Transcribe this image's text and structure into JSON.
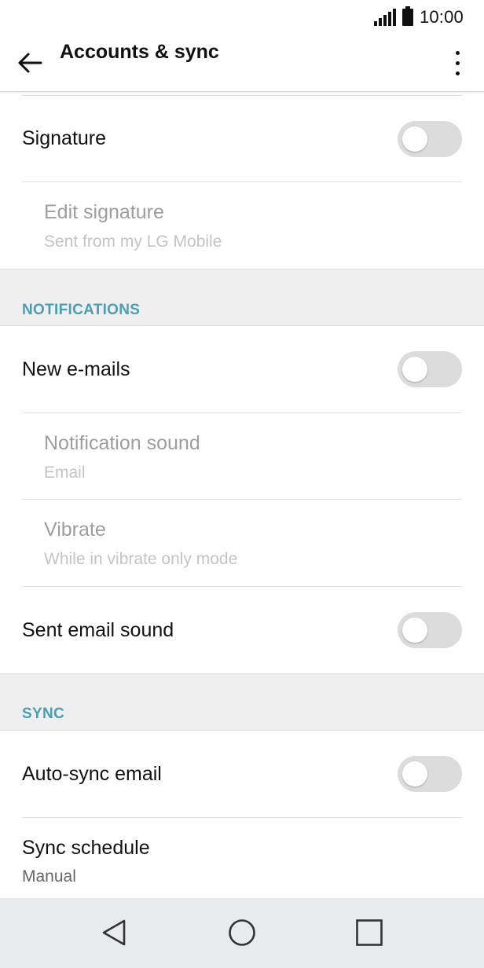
{
  "status_bar": {
    "time": "10:00",
    "icons": [
      "signal-icon",
      "battery-icon"
    ]
  },
  "app_bar": {
    "title": "Accounts & sync",
    "back_icon": "arrow-back-icon",
    "menu_icon": "more-vert-icon"
  },
  "colors": {
    "accent": "#4a9fb5",
    "toggle_off_track": "#dcdcdc",
    "section_bg": "#efefef",
    "nav_bar_bg": "#e9eaee"
  },
  "settings": {
    "signature": {
      "label": "Signature",
      "enabled": false
    },
    "edit_signature": {
      "label": "Edit signature",
      "summary": "Sent from my LG Mobile",
      "disabled": true
    },
    "notifications_header": "NOTIFICATIONS",
    "new_emails": {
      "label": "New e-mails",
      "enabled": false
    },
    "notification_sound": {
      "label": "Notification sound",
      "summary": "Email",
      "disabled": true
    },
    "vibrate": {
      "label": "Vibrate",
      "summary": "While in vibrate only mode",
      "disabled": true
    },
    "sent_email_sound": {
      "label": "Sent email sound",
      "enabled": false
    },
    "sync_header": "SYNC",
    "auto_sync_email": {
      "label": "Auto-sync email",
      "enabled": false
    },
    "sync_schedule": {
      "label": "Sync schedule",
      "summary": "Manual"
    }
  },
  "nav_bar": {
    "buttons": [
      "back-triangle-icon",
      "home-circle-icon",
      "recents-square-icon"
    ]
  }
}
